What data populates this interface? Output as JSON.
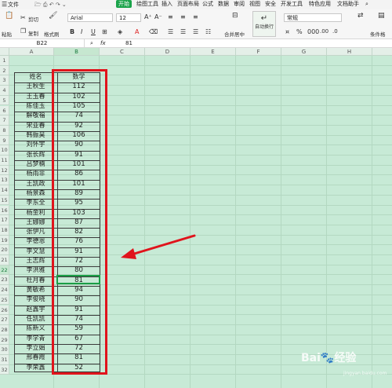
{
  "menubar": {
    "file": "文件",
    "tabs": [
      "开始",
      "绘图工具",
      "插入",
      "页面布局",
      "公式",
      "数据",
      "审阅",
      "视图",
      "安全",
      "开发工具",
      "特色应用",
      "文档助手"
    ]
  },
  "toolbar": {
    "paste": "粘贴",
    "cut": "剪切",
    "copy": "复制",
    "format_painter": "格式刷",
    "font_name": "Arial",
    "font_size": "12",
    "bold": "B",
    "italic": "I",
    "underline": "U",
    "merge_center": "合并居中",
    "wrap_text": "自动换行",
    "number_format": "常规",
    "percent": "%",
    "thousands": "000",
    "increase_decimal": ".00",
    "decrease_decimal": ".0",
    "conditional_format": "条件格"
  },
  "formula_bar": {
    "cell_ref": "B22",
    "fx": "fx",
    "value": "81"
  },
  "sheet": {
    "columns": [
      "A",
      "B",
      "C",
      "D",
      "E",
      "F",
      "G",
      "H",
      "I"
    ],
    "row_count": 32,
    "selected_row": 22,
    "selected_col": "B",
    "header": {
      "name": "姓名",
      "value": "数学"
    },
    "rows": [
      {
        "name": "王秋生",
        "value": "112"
      },
      {
        "name": "王玉春",
        "value": "102"
      },
      {
        "name": "陈佳玉",
        "value": "105"
      },
      {
        "name": "解敬福",
        "value": "74"
      },
      {
        "name": "宋亚春",
        "value": "92"
      },
      {
        "name": "韩振昊",
        "value": "106"
      },
      {
        "name": "刘怀宇",
        "value": "90"
      },
      {
        "name": "张长辉",
        "value": "91"
      },
      {
        "name": "吕梦楠",
        "value": "101"
      },
      {
        "name": "杨雨菲",
        "value": "86"
      },
      {
        "name": "王凯政",
        "value": "101"
      },
      {
        "name": "杨景森",
        "value": "89"
      },
      {
        "name": "李东全",
        "value": "95"
      },
      {
        "name": "杨金利",
        "value": "103"
      },
      {
        "name": "王娜娜",
        "value": "87"
      },
      {
        "name": "张伊凡",
        "value": "82"
      },
      {
        "name": "李德恩",
        "value": "76"
      },
      {
        "name": "李文慧",
        "value": "91"
      },
      {
        "name": "王志辉",
        "value": "72"
      },
      {
        "name": "李洪雅",
        "value": "80"
      },
      {
        "name": "杜月春",
        "value": "81"
      },
      {
        "name": "黄敏希",
        "value": "94"
      },
      {
        "name": "李俊晓",
        "value": "90"
      },
      {
        "name": "赵鑫宇",
        "value": "91"
      },
      {
        "name": "任凯凯",
        "value": "74"
      },
      {
        "name": "陈新义",
        "value": "59"
      },
      {
        "name": "李学青",
        "value": "67"
      },
      {
        "name": "李立娟",
        "value": "72"
      },
      {
        "name": "邢春霞",
        "value": "81"
      },
      {
        "name": "李荣鑫",
        "value": "52"
      }
    ]
  }
}
